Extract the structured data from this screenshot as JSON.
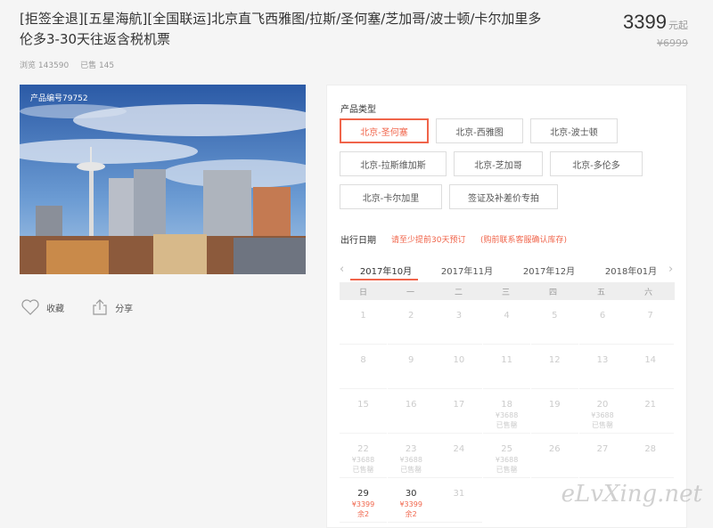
{
  "product": {
    "title": "[拒签全退][五星海航][全国联运]北京直飞西雅图/拉斯/圣何塞/芝加哥/波士顿/卡尔加里多伦多3-30天往返含税机票",
    "price": "3399",
    "price_unit": "元起",
    "original_price": "¥6999",
    "views": "浏览 143590",
    "sold": "已售 145",
    "code": "产品编号79752"
  },
  "actions": {
    "favorite": "收藏",
    "share": "分享"
  },
  "panel": {
    "type_label": "产品类型",
    "options": [
      {
        "label": "北京-圣何塞",
        "selected": true
      },
      {
        "label": "北京-西雅图",
        "selected": false
      },
      {
        "label": "北京-波士顿",
        "selected": false
      },
      {
        "label": "北京-拉斯维加斯",
        "selected": false
      },
      {
        "label": "北京-芝加哥",
        "selected": false
      },
      {
        "label": "北京-多伦多",
        "selected": false
      },
      {
        "label": "北京-卡尔加里",
        "selected": false
      },
      {
        "label": "签证及补差价专拍",
        "selected": false
      }
    ],
    "date_label": "出行日期",
    "hint1": "请至少提前30天预订",
    "hint2": "(购前联系客服确认库存)",
    "months": [
      "2017年10月",
      "2017年11月",
      "2017年12月",
      "2018年01月"
    ],
    "active_month": "2017年10月",
    "weekdays": [
      "日",
      "一",
      "二",
      "三",
      "四",
      "五",
      "六"
    ],
    "days": [
      {
        "d": "1"
      },
      {
        "d": "2"
      },
      {
        "d": "3"
      },
      {
        "d": "4"
      },
      {
        "d": "5"
      },
      {
        "d": "6"
      },
      {
        "d": "7"
      },
      {
        "d": "8"
      },
      {
        "d": "9"
      },
      {
        "d": "10"
      },
      {
        "d": "11"
      },
      {
        "d": "12"
      },
      {
        "d": "13"
      },
      {
        "d": "14"
      },
      {
        "d": "15"
      },
      {
        "d": "16"
      },
      {
        "d": "17"
      },
      {
        "d": "18",
        "p": "¥3688",
        "s": "已售罄"
      },
      {
        "d": "19"
      },
      {
        "d": "20",
        "p": "¥3688",
        "s": "已售罄"
      },
      {
        "d": "21"
      },
      {
        "d": "22",
        "p": "¥3688",
        "s": "已售罄"
      },
      {
        "d": "23",
        "p": "¥3688",
        "s": "已售罄"
      },
      {
        "d": "24"
      },
      {
        "d": "25",
        "p": "¥3688",
        "s": "已售罄"
      },
      {
        "d": "26"
      },
      {
        "d": "27"
      },
      {
        "d": "28"
      },
      {
        "d": "29",
        "p": "¥3399",
        "s": "余2",
        "available": true
      },
      {
        "d": "30",
        "p": "¥3399",
        "s": "余2",
        "available": true
      },
      {
        "d": "31"
      }
    ]
  },
  "watermark": "eLvXing.net",
  "colors": {
    "accent": "#f0644a",
    "sky": "#3a6fb5"
  }
}
